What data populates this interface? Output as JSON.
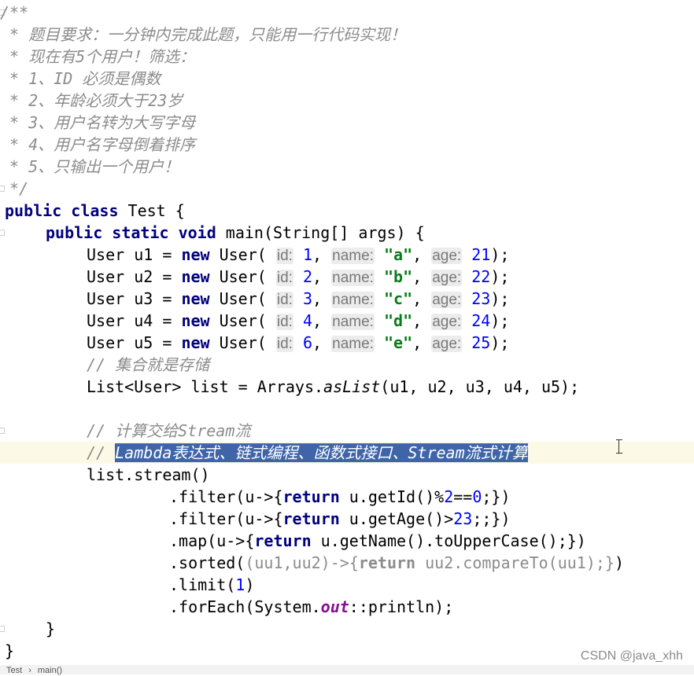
{
  "code": {
    "l1": "/**",
    "l2": " * 题目要求：一分钟内完成此题，只能用一行代码实现！",
    "l3": " * 现在有5个用户！筛选：",
    "l4": " * 1、ID 必须是偶数",
    "l5": " * 2、年龄必须大于23岁",
    "l6": " * 3、用户名转为大写字母",
    "l7": " * 4、用户名字母倒着排序",
    "l8": " * 5、只输出一个用户！",
    "l9": " */",
    "public": "public",
    "class": "class",
    "static": "static",
    "void": "void",
    "new": "new",
    "return": "return",
    "test_decl": " Test {",
    "main_sig": " main(String[] args) {",
    "user_prefix": "User",
    "user_ctor": " User(",
    "hint_id": "id:",
    "hint_name": "name:",
    "hint_age": "age:",
    "users": [
      {
        "var": "u1",
        "id": "1",
        "name": "\"a\"",
        "age": "21"
      },
      {
        "var": "u2",
        "id": "2",
        "name": "\"b\"",
        "age": "22"
      },
      {
        "var": "u3",
        "id": "3",
        "name": "\"c\"",
        "age": "23"
      },
      {
        "var": "u4",
        "id": "4",
        "name": "\"d\"",
        "age": "24"
      },
      {
        "var": "u5",
        "id": "6",
        "name": "\"e\"",
        "age": "25"
      }
    ],
    "cmt_store": "// 集合就是存储",
    "list_decl_a": "List<User> list = Arrays.",
    "list_decl_m": "asList",
    "list_decl_b": "(u1, u2, u3, u4, u5);",
    "cmt_compute": "// 计算交给Stream流",
    "cmt_sel_prefix": "// ",
    "cmt_sel_text": "Lambda表达式、链式编程、函数式接口、Stream流式计算",
    "stream_call": "list.stream()",
    "filter1_a": ".filter(u->{",
    "filter1_b": " u.getId()%",
    "filter1_n": "2",
    "filter1_c": "==",
    "filter1_n2": "0",
    "filter1_d": ";})",
    "filter2_a": ".filter(u->{",
    "filter2_b": " u.getAge()>",
    "filter2_n": "23",
    "filter2_c": ";;})",
    "map_a": ".map(u->{",
    "map_b": " u.getName().toUpperCase();})",
    "sorted_a": ".sorted(",
    "sorted_b": "(uu1,uu2)->{",
    "sorted_c": " uu2.compareTo(uu1);}",
    "sorted_d": ")",
    "limit_a": ".limit(",
    "limit_n": "1",
    "limit_b": ")",
    "foreach_a": ".forEach(System.",
    "foreach_f": "out",
    "foreach_b": "::println);",
    "close_inner": "}",
    "close_outer": "}"
  },
  "watermark": "CSDN @java_xhh",
  "breadcrumb": {
    "item1": "Test",
    "sep": "›",
    "item2": "main()"
  }
}
